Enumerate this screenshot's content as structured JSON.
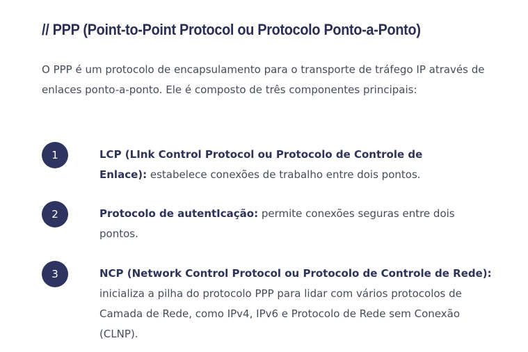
{
  "title": "// PPP (Point-to-Point Protocol ou Protocolo Ponto-a-Ponto)",
  "intro": "O PPP é um protocolo de encapsulamento para o transporte de tráfego IP através de enlaces ponto-a-ponto. Ele é composto de três componentes principais:",
  "items": [
    {
      "number": "1",
      "term": "LCP (LInk Control Protocol ou Protocolo de Controle de Enlace):",
      "description": " estabelece conexões de trabalho entre dois pontos."
    },
    {
      "number": "2",
      "term": "Protocolo de autentIcação:",
      "description": " permite conexões seguras entre dois pontos."
    },
    {
      "number": "3",
      "term": "NCP (Network Control Protocol ou Protocolo de Controle de Rede):",
      "description": " inicializa a pilha do protocolo PPP para lidar com vários protocolos de Camada de Rede, como IPv4, IPv6 e Protocolo de Rede sem Conexão (CLNP)."
    }
  ],
  "colors": {
    "title": "#2b2f55",
    "badge": "#2e3460",
    "body_text": "#474c57"
  }
}
